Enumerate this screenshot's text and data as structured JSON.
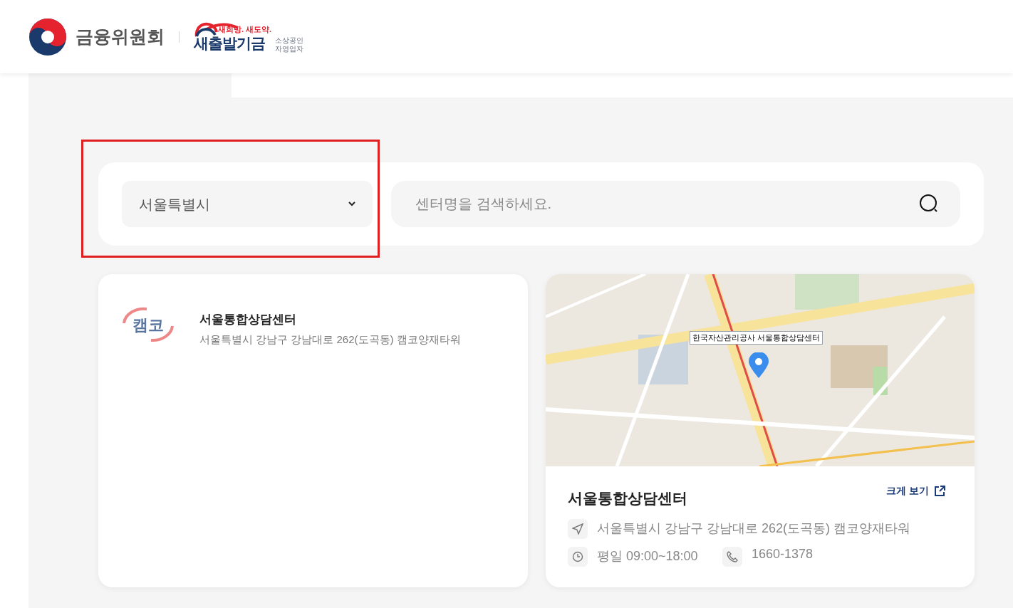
{
  "header": {
    "org_name": "금융위원회",
    "fund_tagline": "새희망. 새도약.",
    "fund_name": "새출발기금",
    "fund_sub": [
      "소상공인",
      "자영업자"
    ]
  },
  "filter": {
    "region": "서울특별시",
    "search_placeholder": "센터명을 검색하세요."
  },
  "list": [
    {
      "logo_text": "캠코",
      "name": "서울통합상담센터",
      "address": "서울특별시 강남구 강남대로 262(도곡동) 캠코양재타워"
    }
  ],
  "detail": {
    "map_label": "한국자산관리공사 서울통합상담센터",
    "name": "서울통합상담센터",
    "enlarge": "크게 보기",
    "address": "서울특별시 강남구 강남대로 262(도곡동) 캠코양재타워",
    "hours": "평일 09:00~18:00",
    "phone": "1660-1378"
  }
}
